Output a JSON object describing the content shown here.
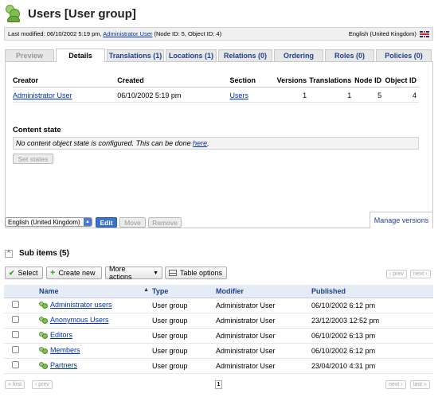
{
  "header": {
    "title": "Users [User group]"
  },
  "modified": {
    "prefix": "Last modified: 06/10/2002 5:19 pm,",
    "author": "Administrator User",
    "ids": "(Node ID: 5, Object ID: 4)",
    "language": "English (United Kingdom)"
  },
  "tabs": [
    {
      "label": "Preview"
    },
    {
      "label": "Details"
    },
    {
      "label": "Translations (1)"
    },
    {
      "label": "Locations (1)"
    },
    {
      "label": "Relations (0)"
    },
    {
      "label": "Ordering"
    },
    {
      "label": "Roles (0)"
    },
    {
      "label": "Policies (0)"
    }
  ],
  "details": {
    "headers": [
      "Creator",
      "Created",
      "Section",
      "Versions",
      "Translations",
      "Node ID",
      "Object ID"
    ],
    "row": [
      "Administrator User",
      "06/10/2002 5:19 pm",
      "Users",
      "1",
      "1",
      "5",
      "4"
    ]
  },
  "content_state": {
    "title": "Content state",
    "message": "No content object state is configured. This can be done",
    "link": "here",
    "button": "Set states"
  },
  "language_bar": {
    "selected": "English (United Kingdom)",
    "edit": "Edit",
    "move": "Move",
    "remove": "Remove",
    "manage_versions": "Manage versions"
  },
  "sub_items": {
    "title": "Sub items (5)",
    "collapse": "^",
    "toolbar": {
      "select": "Select",
      "create_new": "Create new",
      "more_actions": "More actions",
      "table_options": "Table options"
    },
    "pager_top": {
      "prev": "‹ prev",
      "next": "next ›"
    },
    "columns": [
      "Name",
      "Type",
      "Modifier",
      "Published"
    ],
    "rows": [
      {
        "name": "Administrator users",
        "type": "User group",
        "modifier": "Administrator User",
        "published": "06/10/2002 6:12 pm"
      },
      {
        "name": "Anonymous Users",
        "type": "User group",
        "modifier": "Administrator User",
        "published": "23/12/2003 12:52 pm"
      },
      {
        "name": "Editors",
        "type": "User group",
        "modifier": "Administrator User",
        "published": "06/10/2002 6:13 pm"
      },
      {
        "name": "Members",
        "type": "User group",
        "modifier": "Administrator User",
        "published": "06/10/2002 6:12 pm"
      },
      {
        "name": "Partners",
        "type": "User group",
        "modifier": "Administrator User",
        "published": "23/04/2010 4:31 pm"
      }
    ],
    "pager_bottom": {
      "first": "« first",
      "prev": "‹ prev",
      "page": "1",
      "next": "next ›",
      "last": "last »"
    }
  }
}
